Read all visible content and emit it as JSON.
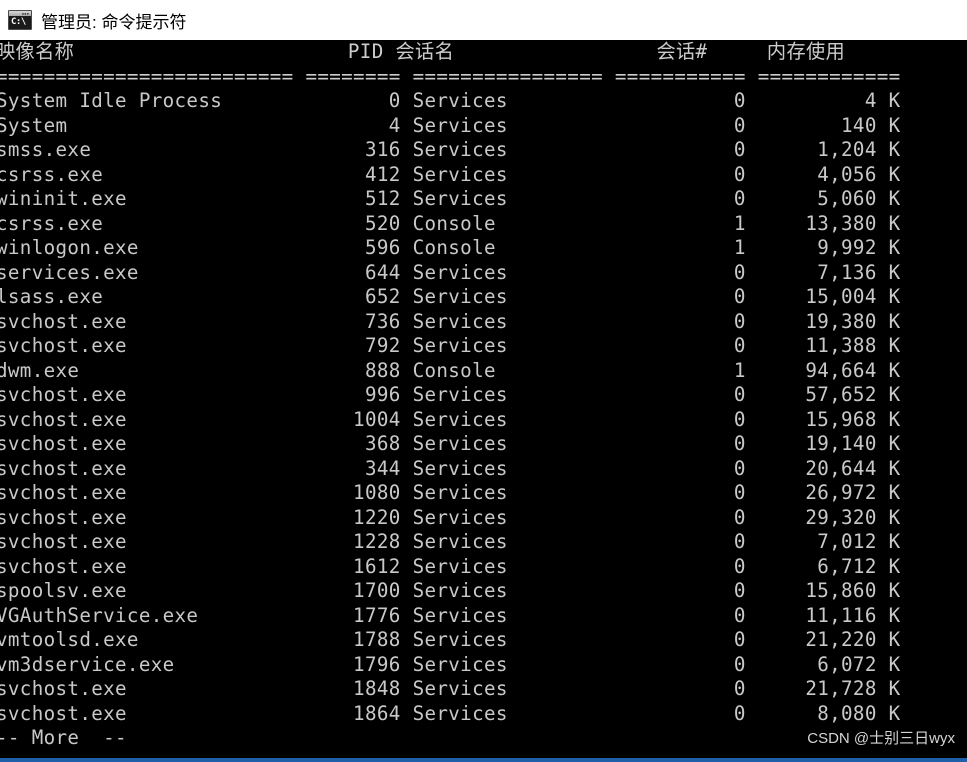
{
  "window": {
    "title": "管理员: 命令提示符",
    "icon": "cmd-icon",
    "icon_prompt": "C:\\",
    "titlebar_bg": "#ffffff",
    "console_bg": "#000000",
    "console_fg": "#c9c9c9",
    "border_color": "#1e5fa8"
  },
  "table": {
    "headers": {
      "image_name": "映像名称",
      "pid": "PID",
      "session_name": "会话名",
      "session_number": "会话#",
      "memory_usage": "内存使用"
    },
    "separators": {
      "image_name": "=========================",
      "pid": "========",
      "session_name": "================",
      "session_number": "===========",
      "memory_usage": "============"
    },
    "rows": [
      {
        "image_name": "System Idle Process",
        "pid": "0",
        "session_name": "Services",
        "session_number": "0",
        "memory_usage": "4 K"
      },
      {
        "image_name": "System",
        "pid": "4",
        "session_name": "Services",
        "session_number": "0",
        "memory_usage": "140 K"
      },
      {
        "image_name": "smss.exe",
        "pid": "316",
        "session_name": "Services",
        "session_number": "0",
        "memory_usage": "1,204 K"
      },
      {
        "image_name": "csrss.exe",
        "pid": "412",
        "session_name": "Services",
        "session_number": "0",
        "memory_usage": "4,056 K"
      },
      {
        "image_name": "wininit.exe",
        "pid": "512",
        "session_name": "Services",
        "session_number": "0",
        "memory_usage": "5,060 K"
      },
      {
        "image_name": "csrss.exe",
        "pid": "520",
        "session_name": "Console",
        "session_number": "1",
        "memory_usage": "13,380 K"
      },
      {
        "image_name": "winlogon.exe",
        "pid": "596",
        "session_name": "Console",
        "session_number": "1",
        "memory_usage": "9,992 K"
      },
      {
        "image_name": "services.exe",
        "pid": "644",
        "session_name": "Services",
        "session_number": "0",
        "memory_usage": "7,136 K"
      },
      {
        "image_name": "lsass.exe",
        "pid": "652",
        "session_name": "Services",
        "session_number": "0",
        "memory_usage": "15,004 K"
      },
      {
        "image_name": "svchost.exe",
        "pid": "736",
        "session_name": "Services",
        "session_number": "0",
        "memory_usage": "19,380 K"
      },
      {
        "image_name": "svchost.exe",
        "pid": "792",
        "session_name": "Services",
        "session_number": "0",
        "memory_usage": "11,388 K"
      },
      {
        "image_name": "dwm.exe",
        "pid": "888",
        "session_name": "Console",
        "session_number": "1",
        "memory_usage": "94,664 K"
      },
      {
        "image_name": "svchost.exe",
        "pid": "996",
        "session_name": "Services",
        "session_number": "0",
        "memory_usage": "57,652 K"
      },
      {
        "image_name": "svchost.exe",
        "pid": "1004",
        "session_name": "Services",
        "session_number": "0",
        "memory_usage": "15,968 K"
      },
      {
        "image_name": "svchost.exe",
        "pid": "368",
        "session_name": "Services",
        "session_number": "0",
        "memory_usage": "19,140 K"
      },
      {
        "image_name": "svchost.exe",
        "pid": "344",
        "session_name": "Services",
        "session_number": "0",
        "memory_usage": "20,644 K"
      },
      {
        "image_name": "svchost.exe",
        "pid": "1080",
        "session_name": "Services",
        "session_number": "0",
        "memory_usage": "26,972 K"
      },
      {
        "image_name": "svchost.exe",
        "pid": "1220",
        "session_name": "Services",
        "session_number": "0",
        "memory_usage": "29,320 K"
      },
      {
        "image_name": "svchost.exe",
        "pid": "1228",
        "session_name": "Services",
        "session_number": "0",
        "memory_usage": "7,012 K"
      },
      {
        "image_name": "svchost.exe",
        "pid": "1612",
        "session_name": "Services",
        "session_number": "0",
        "memory_usage": "6,712 K"
      },
      {
        "image_name": "spoolsv.exe",
        "pid": "1700",
        "session_name": "Services",
        "session_number": "0",
        "memory_usage": "15,860 K"
      },
      {
        "image_name": "VGAuthService.exe",
        "pid": "1776",
        "session_name": "Services",
        "session_number": "0",
        "memory_usage": "11,116 K"
      },
      {
        "image_name": "vmtoolsd.exe",
        "pid": "1788",
        "session_name": "Services",
        "session_number": "0",
        "memory_usage": "21,220 K"
      },
      {
        "image_name": "vm3dservice.exe",
        "pid": "1796",
        "session_name": "Services",
        "session_number": "0",
        "memory_usage": "6,072 K"
      },
      {
        "image_name": "svchost.exe",
        "pid": "1848",
        "session_name": "Services",
        "session_number": "0",
        "memory_usage": "21,728 K"
      },
      {
        "image_name": "svchost.exe",
        "pid": "1864",
        "session_name": "Services",
        "session_number": "0",
        "memory_usage": "8,080 K"
      }
    ]
  },
  "pager": {
    "prompt": "-- More  --"
  },
  "watermark": {
    "text": "CSDN @士别三日wyx"
  },
  "layout": {
    "col_widths": {
      "image_name": 25,
      "pid": 8,
      "session_name": 16,
      "session_number": 11,
      "memory_usage": 12
    }
  }
}
